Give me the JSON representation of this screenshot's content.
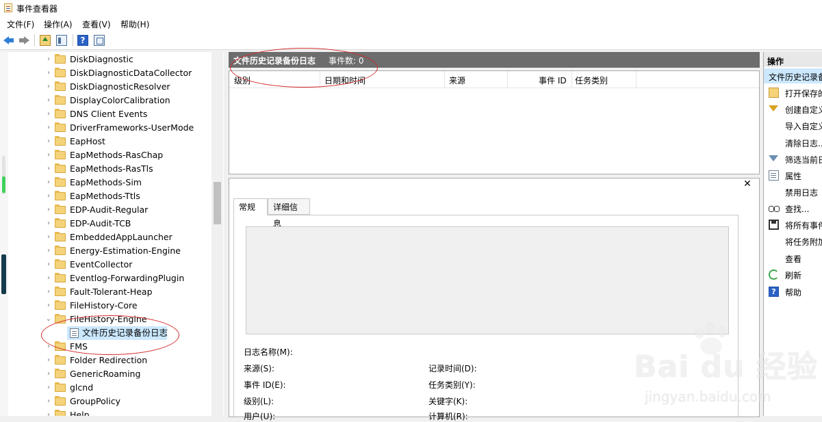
{
  "window": {
    "title": "事件查看器"
  },
  "menu": [
    "文件(F)",
    "操作(A)",
    "查看(V)",
    "帮助(H)"
  ],
  "toolbar": {
    "help_glyph": "?"
  },
  "tree": {
    "items": [
      "DiskDiagnostic",
      "DiskDiagnosticDataCollector",
      "DiskDiagnosticResolver",
      "DisplayColorCalibration",
      "DNS Client Events",
      "DriverFrameworks-UserMode",
      "EapHost",
      "EapMethods-RasChap",
      "EapMethods-RasTls",
      "EapMethods-Sim",
      "EapMethods-Ttls",
      "EDP-Audit-Regular",
      "EDP-Audit-TCB",
      "EmbeddedAppLauncher",
      "Energy-Estimation-Engine",
      "EventCollector",
      "Eventlog-ForwardingPlugin",
      "Fault-Tolerant-Heap",
      "FileHistory-Core",
      "FileHistory-Engine"
    ],
    "expanded_child": "文件历史记录备份日志",
    "items_after": [
      "FMS",
      "Folder Redirection",
      "GenericRoaming",
      "glcnd",
      "GroupPolicy",
      "Help"
    ],
    "chevron_collapsed": "›",
    "chevron_expanded": "⌄"
  },
  "middle": {
    "title": "文件历史记录备份日志",
    "count": "事件数: 0",
    "columns": [
      "级别",
      "日期和时间",
      "来源",
      "事件 ID",
      "任务类别"
    ],
    "close_glyph": "✕",
    "tabs": [
      "常规",
      "详细信息"
    ],
    "fields_left": [
      "日志名称(M):",
      "来源(S):",
      "事件 ID(E):",
      "级别(L):",
      "用户(U):"
    ],
    "fields_right": [
      "记录时间(D):",
      "任务类别(Y):",
      "关键字(K):",
      "计算机(R):"
    ]
  },
  "actions": {
    "header": "操作",
    "selected": "文件历史记录备份日志",
    "items": [
      {
        "label": "打开保存的日志...",
        "icon": "folder-open-icon"
      },
      {
        "label": "创建自定义视图...",
        "icon": "filter-icon"
      },
      {
        "label": "导入自定义视图...",
        "icon": ""
      },
      {
        "label": "清除日志...",
        "icon": ""
      },
      {
        "label": "筛选当前日志...",
        "icon": "filter-icon"
      },
      {
        "label": "属性",
        "icon": "properties-icon"
      },
      {
        "label": "禁用日志",
        "icon": ""
      },
      {
        "label": "查找...",
        "icon": "binoculars-icon"
      },
      {
        "label": "将所有事件另存为...",
        "icon": "save-icon"
      },
      {
        "label": "将任务附加到此日志...",
        "icon": ""
      },
      {
        "label": "查看",
        "icon": ""
      },
      {
        "label": "刷新",
        "icon": "refresh-icon"
      },
      {
        "label": "帮助",
        "icon": "help-icon"
      }
    ]
  },
  "watermark": {
    "brand": "Bai du 经验",
    "url": "jingyan.baidu.com"
  },
  "colors": {
    "header_bg": "#6d6d6d",
    "selection": "#cce8ff",
    "annotation": "#d42a2a",
    "folder": "#f5d37a"
  }
}
